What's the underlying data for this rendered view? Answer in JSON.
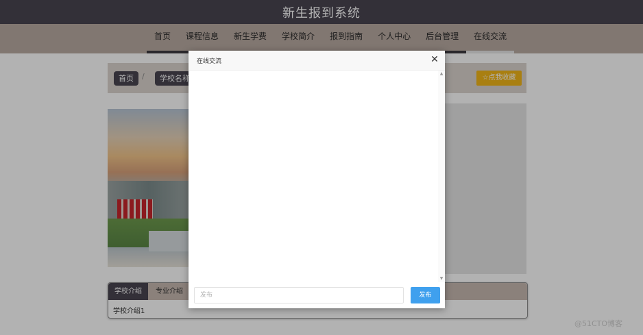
{
  "header": {
    "title": "新生报到系统"
  },
  "nav": {
    "items": [
      "首页",
      "课程信息",
      "新生学费",
      "学校简介",
      "报到指南",
      "个人中心",
      "后台管理",
      "在线交流"
    ],
    "active_index": 7
  },
  "breadcrumb": {
    "home": "首页",
    "current": "学校名称",
    "separator": "/"
  },
  "favorite_button": {
    "label": "点我收藏",
    "icon": "star-outline-icon"
  },
  "tabs": {
    "items": [
      "学校介绍",
      "专业介绍"
    ],
    "active": "学校介绍",
    "content": "学校介绍1"
  },
  "modal": {
    "title": "在线交流",
    "close_icon": "close-icon",
    "input_placeholder": "发布",
    "input_value": "",
    "submit_label": "发布"
  },
  "watermark": "@51CTO博客",
  "colors": {
    "header_bg": "#4a4651",
    "nav_bg": "#b9aba2",
    "accent_yellow": "#f3b619",
    "primary_blue": "#3fa0ee"
  }
}
